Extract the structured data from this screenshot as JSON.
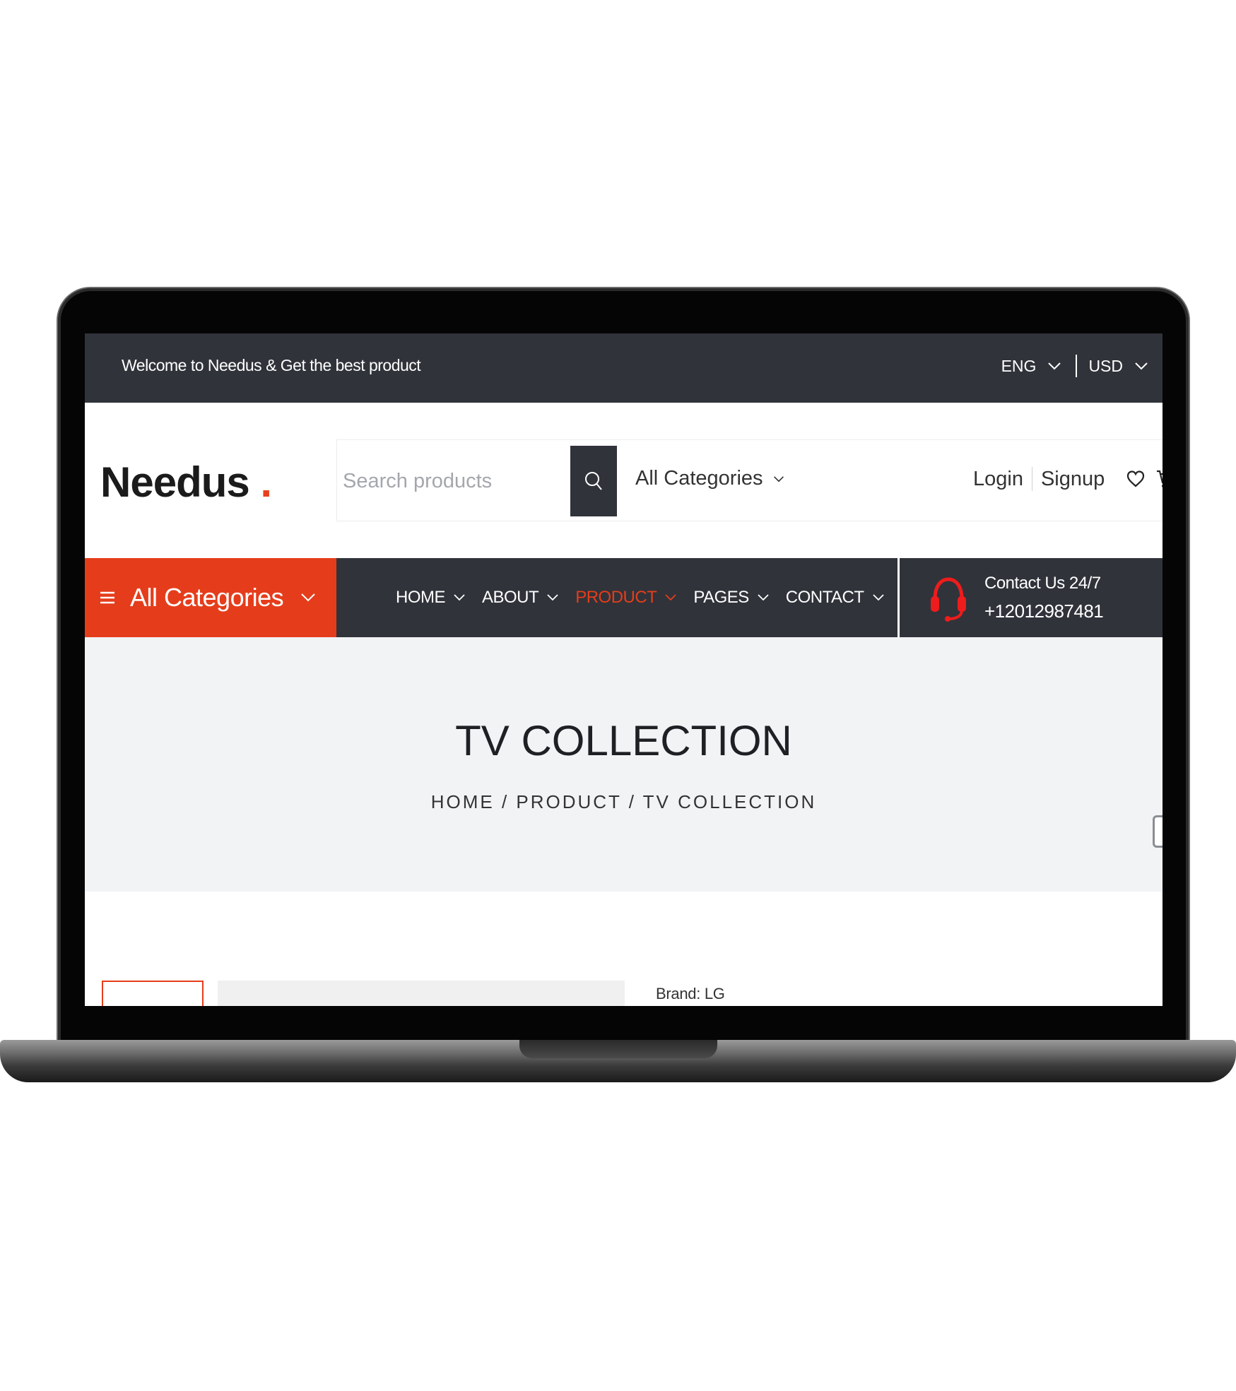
{
  "topbar": {
    "welcome": "Welcome to Needus & Get the best product",
    "language": "ENG",
    "currency": "USD"
  },
  "header": {
    "logo": "Needus",
    "logo_dot": ".",
    "search_placeholder": "Search products",
    "category_select": "All Categories",
    "login": "Login",
    "signup": "Signup"
  },
  "nav": {
    "all_categories": "All Categories",
    "items": [
      {
        "label": "HOME"
      },
      {
        "label": "ABOUT"
      },
      {
        "label": "PRODUCT"
      },
      {
        "label": "PAGES"
      },
      {
        "label": "CONTACT"
      }
    ],
    "contact_title": "Contact Us 24/7",
    "contact_phone": "+12012987481"
  },
  "hero": {
    "title": "TV COLLECTION",
    "breadcrumb": "HOME / PRODUCT / TV COLLECTION"
  },
  "product": {
    "brand": "Brand: LG"
  },
  "colors": {
    "accent": "#e53d1b",
    "dark": "#30333a",
    "hero_bg": "#f2f3f5"
  },
  "icons": [
    "search-icon",
    "chevron-down-icon",
    "heart-icon",
    "cart-icon",
    "menu-icon",
    "headset-icon"
  ]
}
